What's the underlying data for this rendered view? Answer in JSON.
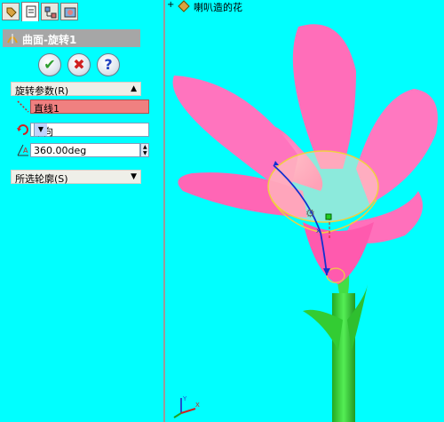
{
  "tabs": [
    {
      "name": "feature-manager"
    },
    {
      "name": "property-manager"
    },
    {
      "name": "configuration-manager"
    },
    {
      "name": "display-manager"
    }
  ],
  "feature": {
    "title": "曲面-旋转1",
    "icon": "revolve-surface-icon"
  },
  "actions": {
    "ok_symbol": "✔",
    "cancel_symbol": "✖",
    "help_symbol": "?"
  },
  "revolve_params": {
    "header": "旋转参数(R)",
    "axis_value": "直线1",
    "direction_value": "单向",
    "angle_value": "360.00deg"
  },
  "selected_contours": {
    "header": "所选轮廓(S)"
  },
  "tree": {
    "label": "喇叭造的花"
  },
  "colors": {
    "background": "#00ffff",
    "petal": "#ff6fb8",
    "stem": "#33cc33"
  }
}
